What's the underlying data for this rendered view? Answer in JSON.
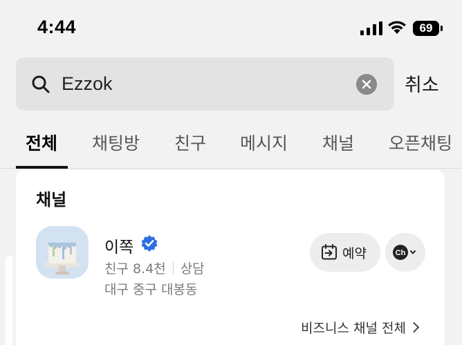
{
  "status_bar": {
    "time": "4:44",
    "battery": "69"
  },
  "search": {
    "value": "Ezzok",
    "cancel_label": "취소"
  },
  "tabs": [
    {
      "label": "전체",
      "active": true
    },
    {
      "label": "채팅방",
      "active": false
    },
    {
      "label": "친구",
      "active": false
    },
    {
      "label": "메시지",
      "active": false
    },
    {
      "label": "채널",
      "active": false
    },
    {
      "label": "오픈채팅",
      "active": false
    }
  ],
  "channel_section": {
    "title": "채널",
    "item": {
      "name": "이쪽",
      "friends": "친구 8.4천",
      "consult": "상담",
      "address": "대구 중구 대봉동",
      "reserve_label": "예약",
      "chat_icon_label": "Ch"
    },
    "more_label": "비즈니스 채널 전체"
  },
  "colors": {
    "verified": "#2f6fe0",
    "background": "#f2f2f2",
    "card": "#ffffff"
  }
}
